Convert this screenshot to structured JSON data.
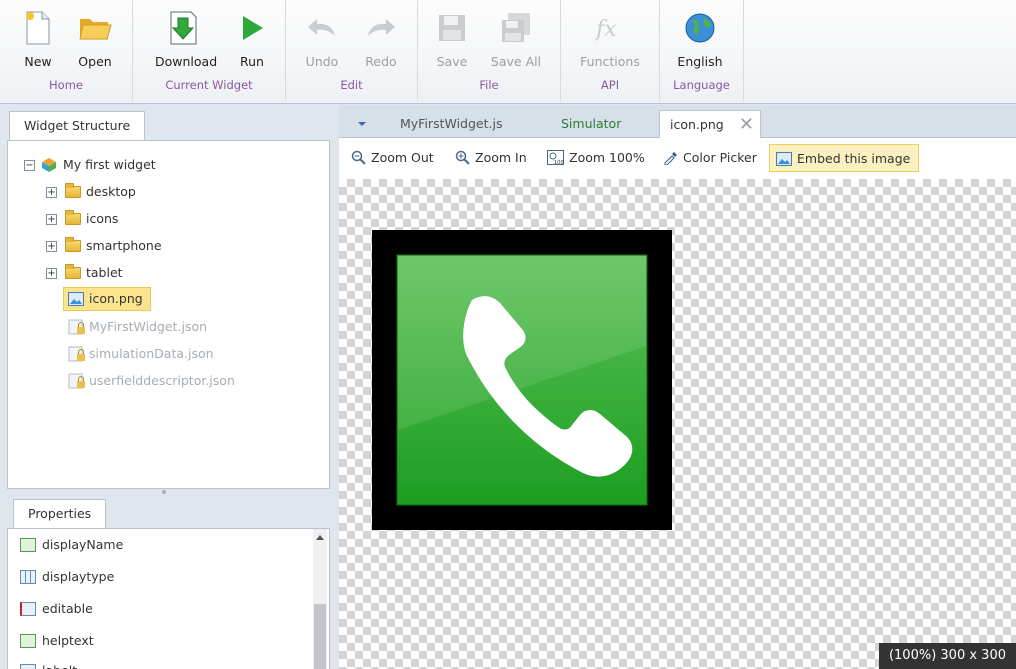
{
  "ribbon": {
    "groups": [
      {
        "label": "Home",
        "buttons": [
          {
            "label": "New",
            "icon": "new-file-icon"
          },
          {
            "label": "Open",
            "icon": "open-folder-icon"
          }
        ]
      },
      {
        "label": "Current Widget",
        "buttons": [
          {
            "label": "Download",
            "icon": "download-icon"
          },
          {
            "label": "Run",
            "icon": "run-icon"
          }
        ]
      },
      {
        "label": "Edit",
        "buttons": [
          {
            "label": "Undo",
            "icon": "undo-icon"
          },
          {
            "label": "Redo",
            "icon": "redo-icon"
          }
        ]
      },
      {
        "label": "File",
        "buttons": [
          {
            "label": "Save",
            "icon": "save-icon"
          },
          {
            "label": "Save All",
            "icon": "save-all-icon"
          }
        ]
      },
      {
        "label": "API",
        "buttons": [
          {
            "label": "Functions",
            "icon": "functions-icon"
          }
        ]
      },
      {
        "label": "Language",
        "buttons": [
          {
            "label": "English",
            "icon": "globe-icon"
          }
        ]
      }
    ]
  },
  "structure": {
    "tab": "Widget Structure",
    "root": "My first widget",
    "folders": [
      "desktop",
      "icons",
      "smartphone",
      "tablet"
    ],
    "selected_file": "icon.png",
    "locked_files": [
      "MyFirstWidget.json",
      "simulationData.json",
      "userfielddescriptor.json"
    ]
  },
  "properties": {
    "tab": "Properties",
    "items": [
      "displayName",
      "displaytype",
      "editable",
      "helptext",
      "labelt"
    ]
  },
  "editor": {
    "tabs": [
      "MyFirstWidget.js",
      "Simulator",
      "icon.png"
    ],
    "toolbar": [
      "Zoom Out",
      "Zoom In",
      "Zoom 100%",
      "Color Picker",
      "Embed this image"
    ],
    "status": "(100%) 300 x 300"
  },
  "colors": {
    "accent_purple": "#8a5aa0",
    "run_green": "#2faa3a",
    "simulator_green": "#2e7d32",
    "selection": "#fbe48d"
  }
}
